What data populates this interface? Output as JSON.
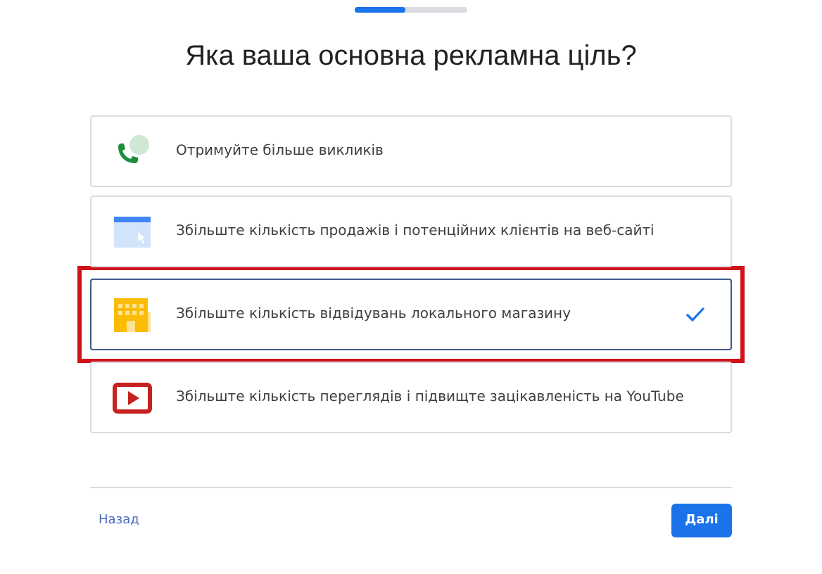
{
  "progress": {
    "level": 0.45
  },
  "title": "Яка ваша основна рекламна ціль?",
  "goals": [
    {
      "kind": "calls",
      "label": "Отримуйте більше викликів",
      "selected": false
    },
    {
      "kind": "website",
      "label": "Збільште кількість продажів і потенційних клієнтів на веб-сайті",
      "selected": false
    },
    {
      "kind": "store",
      "label": "Збільште кількість відвідувань локального магазину",
      "selected": true
    },
    {
      "kind": "video",
      "label": "Збільште кількість переглядів і підвищте зацікавленість на YouTube",
      "selected": false
    }
  ],
  "back_link": "Назад",
  "next_button": "Далі"
}
